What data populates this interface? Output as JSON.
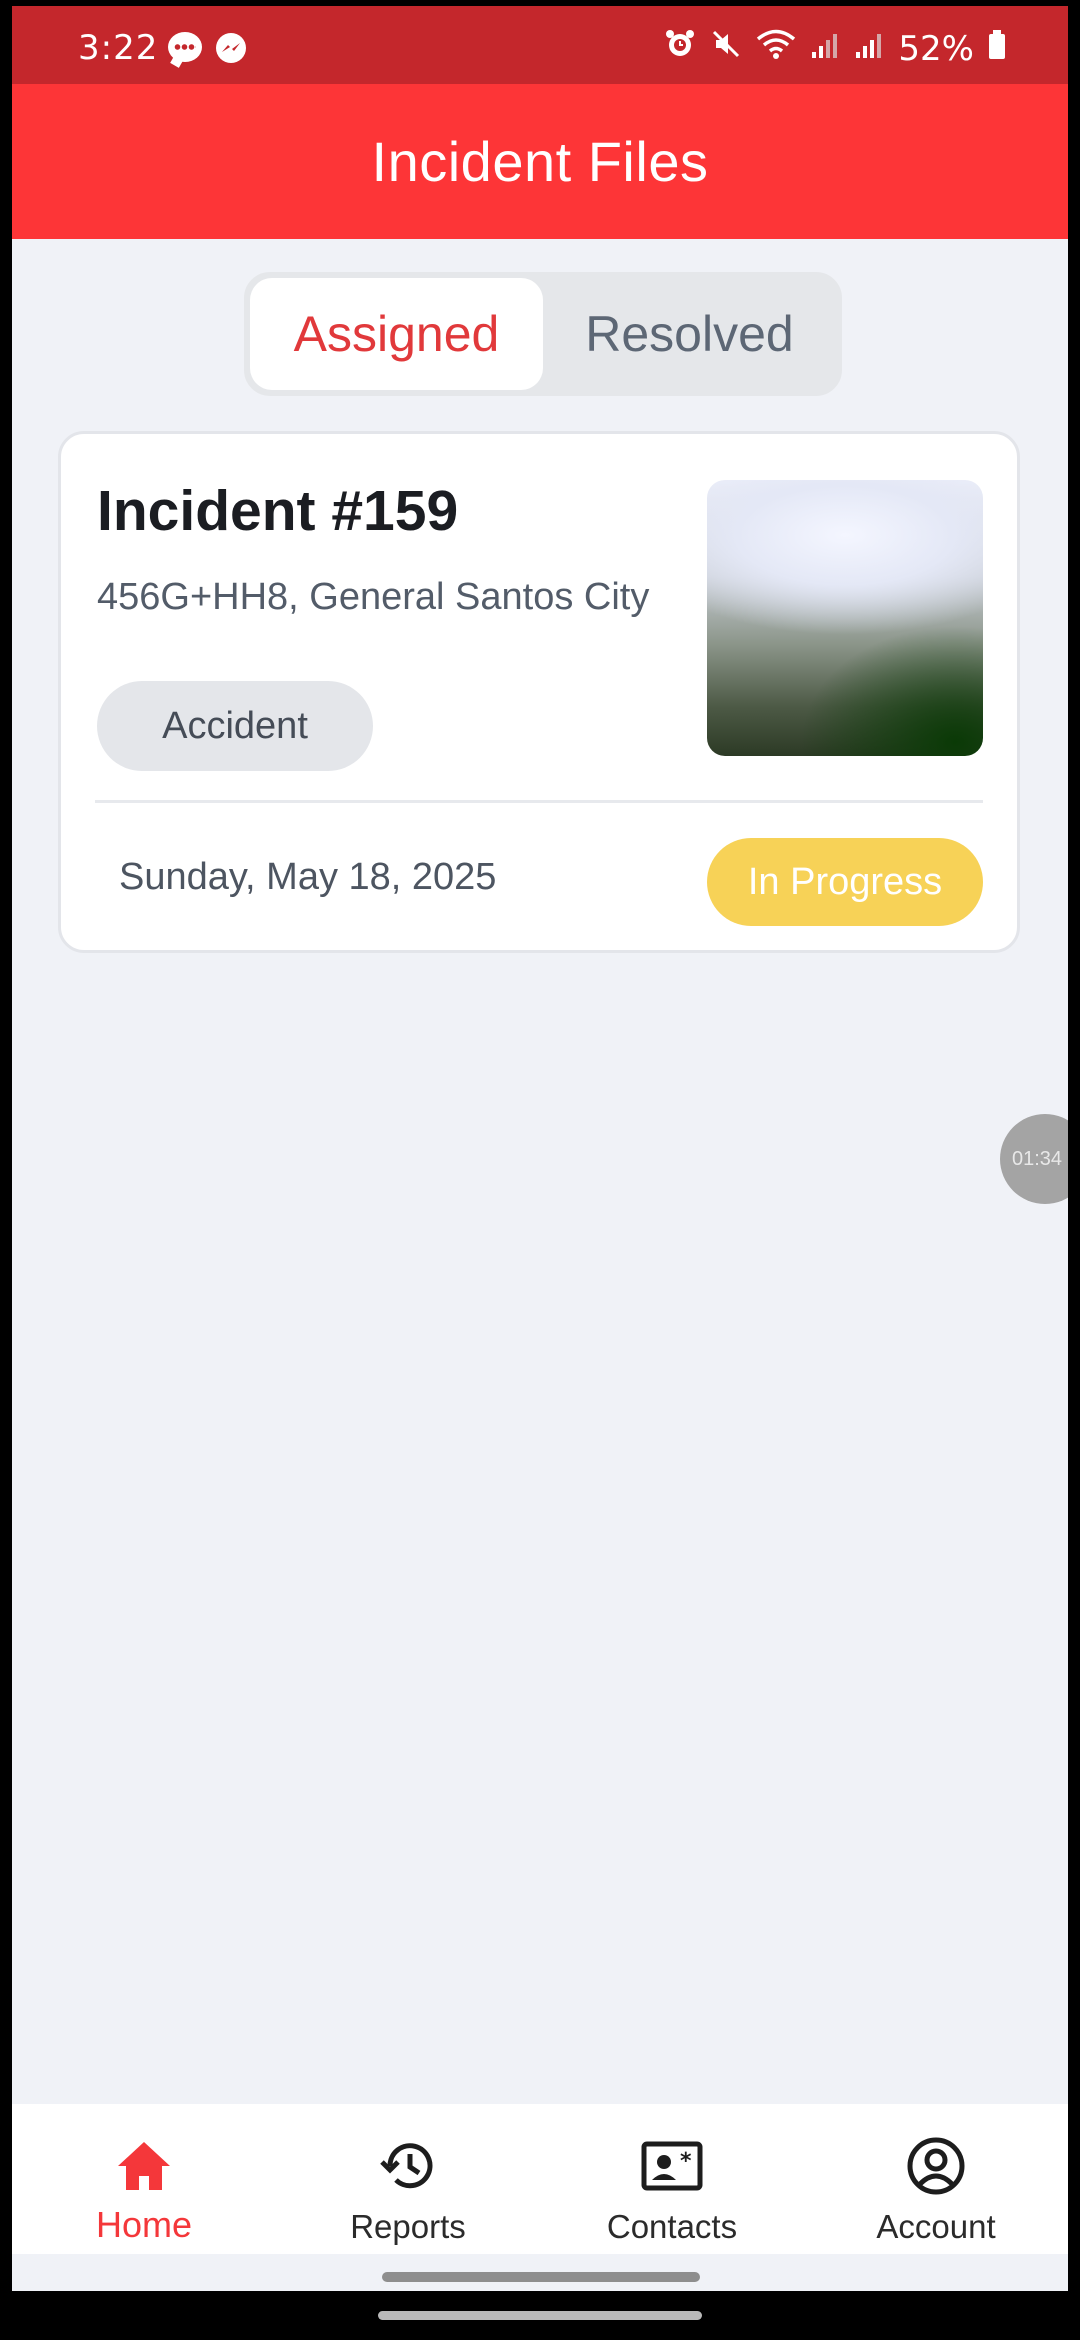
{
  "status_bar": {
    "time": "3:22",
    "battery": "52%",
    "icons": [
      "chat-bubble-icon",
      "messenger-icon",
      "alarm-icon",
      "mute-icon",
      "wifi-icon",
      "signal-icon",
      "signal-icon",
      "battery-icon"
    ]
  },
  "header": {
    "title": "Incident Files"
  },
  "tabs": [
    {
      "label": "Assigned",
      "active": true
    },
    {
      "label": "Resolved",
      "active": false
    }
  ],
  "incidents": [
    {
      "title": "Incident #159",
      "address": "456G+HH8, General Santos City",
      "category": "Accident",
      "date": "Sunday, May 18, 2025",
      "status": "In Progress",
      "status_color": "#f7d257"
    }
  ],
  "floating_timer": {
    "label": "01:34"
  },
  "bottom_nav": [
    {
      "label": "Home",
      "icon": "home-icon",
      "active": true
    },
    {
      "label": "Reports",
      "icon": "history-icon",
      "active": false
    },
    {
      "label": "Contacts",
      "icon": "contact-card-icon",
      "active": false
    },
    {
      "label": "Account",
      "icon": "account-icon",
      "active": false
    }
  ],
  "colors": {
    "status_bar": "#c4272c",
    "header": "#fd3537",
    "accent": "#f4373a",
    "background": "#f0f2f7"
  }
}
